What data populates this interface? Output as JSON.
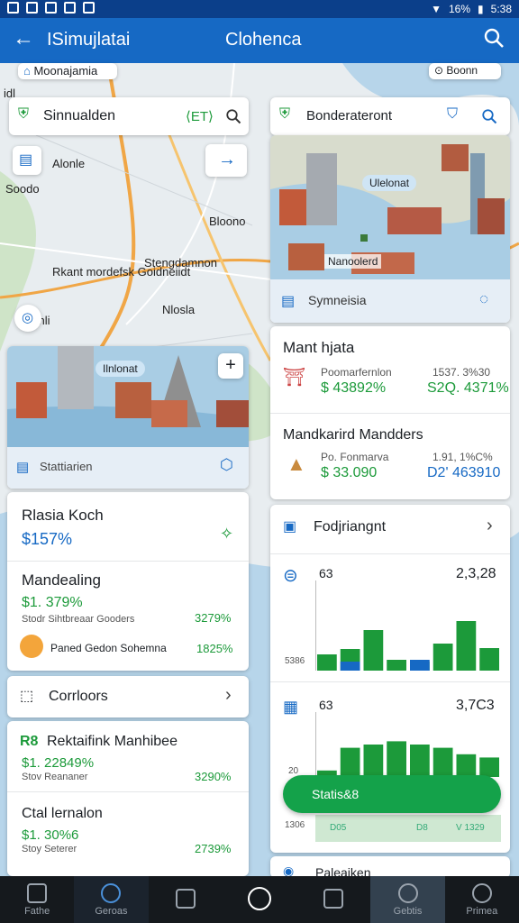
{
  "status_bar": {
    "battery": "16%",
    "time": "5:38"
  },
  "app_bar": {
    "title": "ISimujlatai",
    "center_title": "Clohenca"
  },
  "map_labels": {
    "top_pin": "Moonajamia",
    "top_right": "Boonn",
    "left_a": "Alonle",
    "left_b": "Soodo",
    "center_a": "Rkant mordefsk Goidneiidt",
    "center_b": "Bloono",
    "center_c": "Stengdamnon",
    "center_d": "Nlosla",
    "left_c": "Iinli",
    "top_left_edge": "idl"
  },
  "search_left": {
    "text": "Sinnualden",
    "tag": "⟨ET⟩"
  },
  "search_right": {
    "text": "Bonderateront"
  },
  "scene_left": {
    "badge": "Ilnlonat",
    "footer": "Stattiarien"
  },
  "scene_right": {
    "badge": "Ulelonat",
    "badge2": "Nanoolerd",
    "footer": "Symneisia"
  },
  "left_panel1": {
    "title": "Rlasia Koch",
    "value": "$157%"
  },
  "left_panel2": {
    "title": "Mandealing",
    "value": "$1. 379%",
    "sub": "Stodr Sihtbreaar Gooders",
    "sub_value": "3279%",
    "row_label": "Paned Gedon Sohemna",
    "row_value": "1825%"
  },
  "left_corridors": {
    "label": "Corrloors"
  },
  "left_panel3": {
    "title": "Rektaifink Manhibee",
    "badge": "R8",
    "value": "$1. 22849%",
    "sub": "Stov Reananer",
    "sub_value": "3290%"
  },
  "left_panel4": {
    "title": "Ctal lernalon",
    "value": "$1. 30%6",
    "sub": "Stoy Seterer",
    "sub_value": "2739%"
  },
  "right_panel1": {
    "title": "Mant hjata",
    "sub_label": "Poomarfernlon",
    "sub_value": "1537. 3%30",
    "value": "$ 43892%",
    "value2": "S2Q. 4371%"
  },
  "right_panel2": {
    "title": "Mandkarird Mandders",
    "sub_label": "Po. Fonmarva",
    "sub_value": "1.91, 1%C%",
    "value": "$ 33.090",
    "value2": "D2' 463910"
  },
  "right_header": {
    "label": "Fodjriangnt"
  },
  "chart1": {
    "left_value": "63",
    "right_value": "2,3,28",
    "axis_label": "5386"
  },
  "chart2": {
    "left_value": "63",
    "right_value": "3,7C3",
    "axis_label_a": "20",
    "axis_label_b": "1306",
    "button": "Statis&8",
    "tick_a": "D05",
    "tick_b": "D8",
    "tick_c": "V 1329"
  },
  "right_footer": {
    "label": "Paleaiken"
  },
  "chart_data": [
    {
      "type": "bar",
      "series": [
        {
          "name": "",
          "values": [
            0.18,
            0.24,
            0.45,
            0.12,
            0.1,
            0.3,
            0.55,
            0.25
          ]
        },
        {
          "name": "",
          "values": [
            0,
            0.1,
            0,
            0,
            0.12,
            0,
            0,
            0
          ]
        }
      ]
    },
    {
      "type": "bar",
      "series": [
        {
          "name": "",
          "values": [
            0.1,
            0.45,
            0.5,
            0.55,
            0.5,
            0.45,
            0.35,
            0.3
          ]
        }
      ]
    }
  ],
  "bottom_nav": [
    {
      "label": "Fathe"
    },
    {
      "label": "Geroas"
    },
    {
      "label": ""
    },
    {
      "label": ""
    },
    {
      "label": ""
    },
    {
      "label": "Gebtis"
    },
    {
      "label": "Primea"
    }
  ],
  "colors": {
    "primary": "#1669c4",
    "green": "#1c9a3a",
    "dark_bar": "#15191d"
  }
}
